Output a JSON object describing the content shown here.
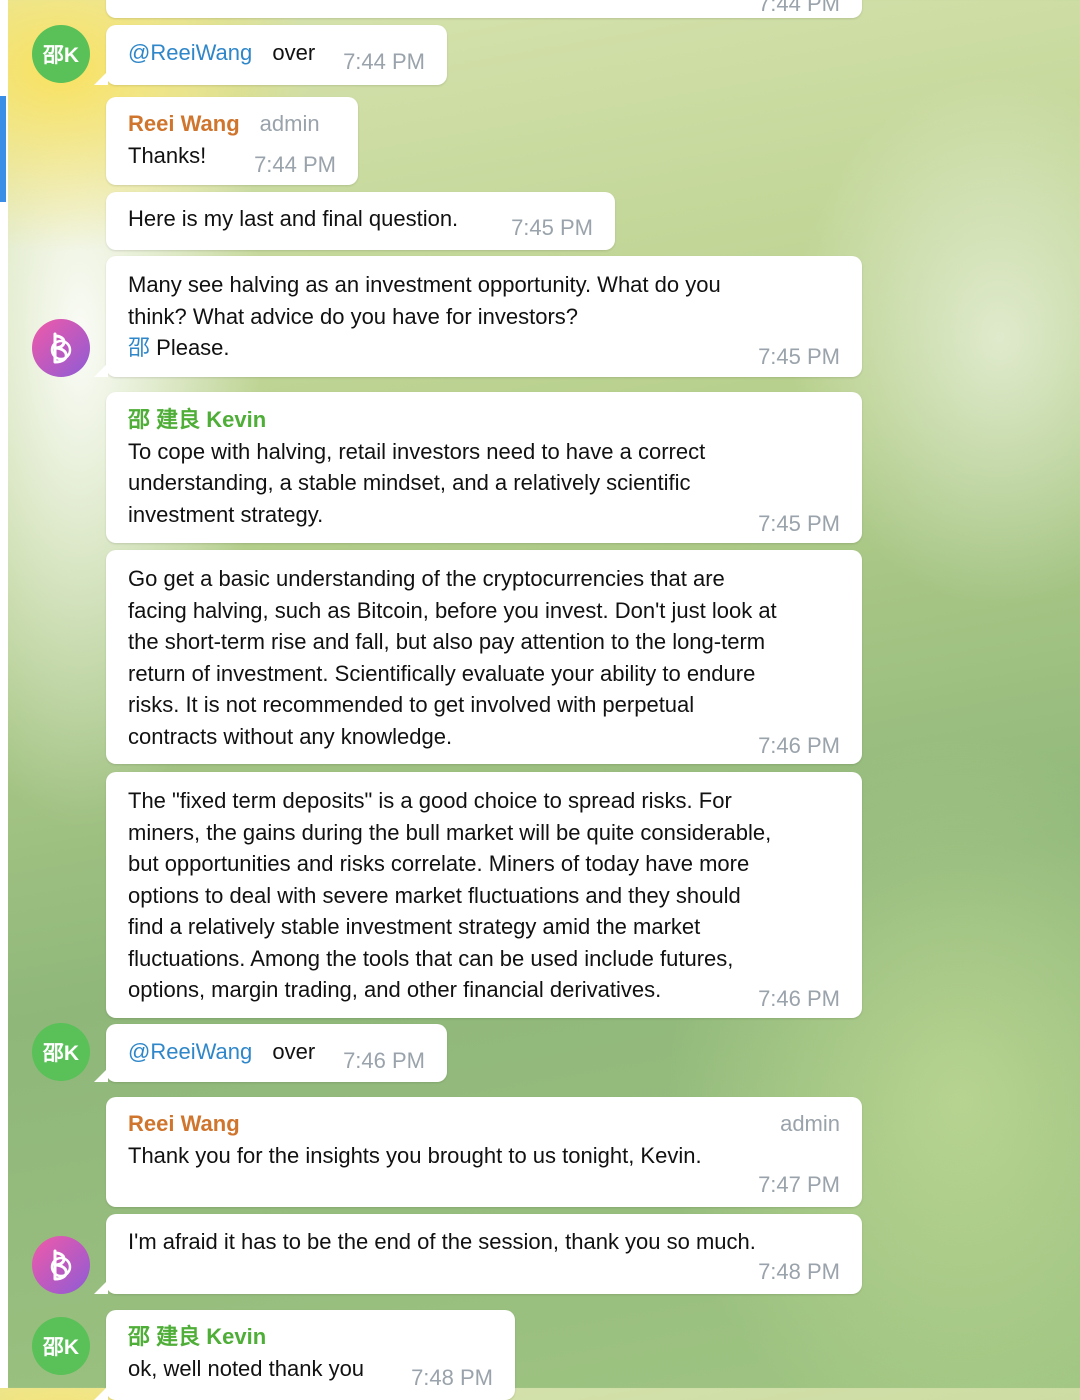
{
  "chat": {
    "messages": [
      {
        "id": "m0",
        "time": "7:44 PM"
      },
      {
        "id": "m1",
        "avatar": "邵K",
        "mention": "@ReeiWang",
        "text": "over",
        "time": "7:44 PM"
      },
      {
        "id": "m2",
        "sender": "Reei Wang",
        "role": "admin",
        "text": "Thanks!",
        "time": "7:44 PM"
      },
      {
        "id": "m3",
        "text": "Here is my last and final question.",
        "time": "7:45 PM"
      },
      {
        "id": "m4",
        "avatar_icon": "bi-logo-icon",
        "lines": [
          "Many see halving as an investment opportunity. What do you",
          "think? What advice do you have for investors?"
        ],
        "mention": "邵",
        "tail_text": "Please.",
        "time": "7:45 PM"
      },
      {
        "id": "m5",
        "sender": "邵 建良 Kevin",
        "lines": [
          "To cope with halving, retail investors need to have a correct",
          "understanding, a stable mindset, and a relatively scientific",
          "investment strategy."
        ],
        "time": "7:45 PM"
      },
      {
        "id": "m6",
        "lines": [
          "Go get a basic understanding of the cryptocurrencies that are",
          "facing halving, such as Bitcoin, before you invest. Don't just look at",
          "the short-term rise and fall, but also pay attention to the long-term",
          "return of investment. Scientifically evaluate your ability to endure",
          "risks. It is not recommended to get involved with perpetual",
          "contracts without any knowledge."
        ],
        "time": "7:46 PM"
      },
      {
        "id": "m7",
        "lines": [
          "The \"fixed term deposits\" is a good choice to spread risks. For",
          "miners, the gains during the bull market will be quite considerable,",
          "but opportunities and risks correlate. Miners of today have more",
          "options to deal with severe market fluctuations and they should",
          "find a relatively stable investment strategy amid the market",
          "fluctuations. Among the tools that can be used include futures,",
          "options, margin trading, and other financial derivatives."
        ],
        "time": "7:46 PM"
      },
      {
        "id": "m8",
        "avatar": "邵K",
        "mention": "@ReeiWang",
        "text": "over",
        "time": "7:46 PM"
      },
      {
        "id": "m9",
        "sender": "Reei Wang",
        "role": "admin",
        "text": "Thank you for the insights you brought to us tonight, Kevin.",
        "time": "7:47 PM"
      },
      {
        "id": "m10",
        "avatar_icon": "bi-logo-icon",
        "text": "I'm afraid it has to be the end of the session, thank you so much.",
        "time": "7:48 PM"
      },
      {
        "id": "m11",
        "avatar": "邵K",
        "sender": "邵 建良 Kevin",
        "text": "ok, well noted thank you",
        "time": "7:48 PM"
      }
    ]
  },
  "colors": {
    "mention": "#2f87c9",
    "admin_name": "#d0752e",
    "kevin_name": "#4fae38",
    "time": "#9aa3ab",
    "accent": "#3a8ee6"
  }
}
